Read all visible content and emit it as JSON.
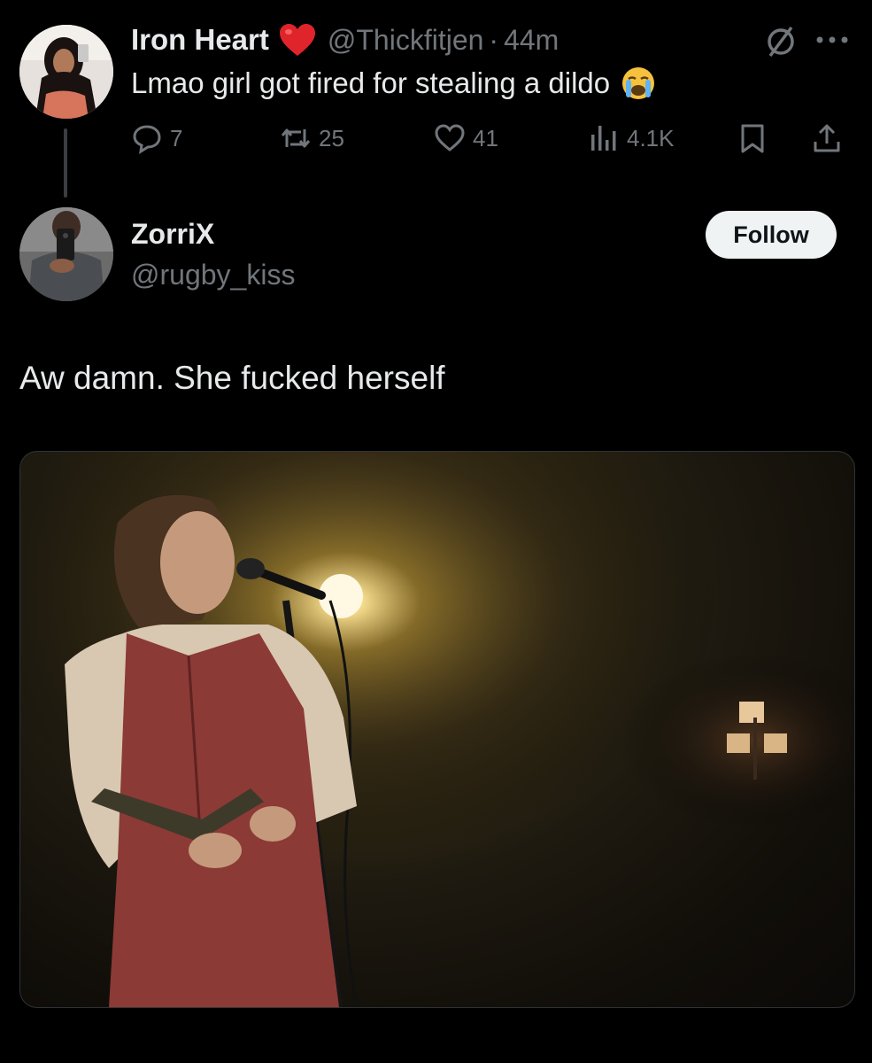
{
  "parent_tweet": {
    "display_name": "Iron Heart",
    "handle": "@Thickfitjen",
    "separator": "·",
    "time": "44m",
    "text": "Lmao girl got fired for stealing a dildo",
    "emoji": "loudly-crying-face-emoji",
    "badge": "red-heart-emoji",
    "stats": {
      "replies": "7",
      "retweets": "25",
      "likes": "41",
      "views": "4.1K"
    },
    "icons": [
      "reply-icon",
      "retweet-icon",
      "like-icon",
      "views-icon",
      "bookmark-icon",
      "share-icon",
      "muted-icon",
      "more-icon"
    ]
  },
  "reply_tweet": {
    "display_name": "ZorriX",
    "handle": "@rugby_kiss",
    "follow_label": "Follow",
    "text": "Aw damn. She fucked herself"
  },
  "colors": {
    "background": "#000000",
    "primary_text": "#e7e9ea",
    "secondary_text": "#71767b",
    "follow_button_bg": "#eff3f4"
  }
}
